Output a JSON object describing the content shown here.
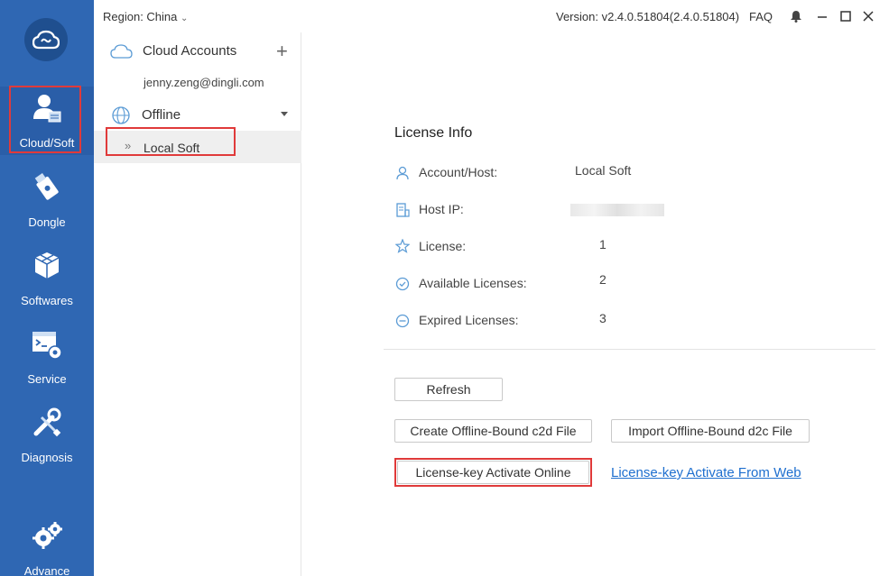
{
  "topbar": {
    "region": "Region: China",
    "version": "Version: v2.4.0.51804(2.4.0.51804)",
    "faq": "FAQ"
  },
  "nav": {
    "items": [
      {
        "label": "Cloud/Soft",
        "icon": "user-card-icon"
      },
      {
        "label": "Dongle",
        "icon": "usb-dongle-icon"
      },
      {
        "label": "Softwares",
        "icon": "cubes-icon"
      },
      {
        "label": "Service",
        "icon": "terminal-gear-icon"
      },
      {
        "label": "Diagnosis",
        "icon": "tools-icon"
      },
      {
        "label": "Advance",
        "icon": "gears-icon"
      }
    ]
  },
  "tree": {
    "cloud_accounts": "Cloud Accounts",
    "account_email": "jenny.zeng@dingli.com",
    "offline": "Offline",
    "local_soft": "Local Soft"
  },
  "license": {
    "title": "License Info",
    "rows": [
      {
        "label": "Account/Host:",
        "value": "Local Soft",
        "icon": "user-icon"
      },
      {
        "label": "Host IP:",
        "value": "",
        "icon": "host-icon"
      },
      {
        "label": "License:",
        "value": "1",
        "icon": "star-icon"
      },
      {
        "label": "Available Licenses:",
        "value": "2",
        "icon": "check-circle-icon"
      },
      {
        "label": "Expired Licenses:",
        "value": "3",
        "icon": "minus-circle-icon"
      }
    ]
  },
  "actions": {
    "refresh": "Refresh",
    "create_c2d": "Create Offline-Bound c2d File",
    "import_d2c": "Import Offline-Bound d2c File",
    "activate_online": "License-key Activate Online",
    "activate_web": "License-key Activate From Web"
  },
  "colors": {
    "nav_bg": "#2f67b3",
    "highlight": "#e03a3a",
    "link": "#1e6fcf",
    "icon_blue": "#5b9bd5"
  }
}
